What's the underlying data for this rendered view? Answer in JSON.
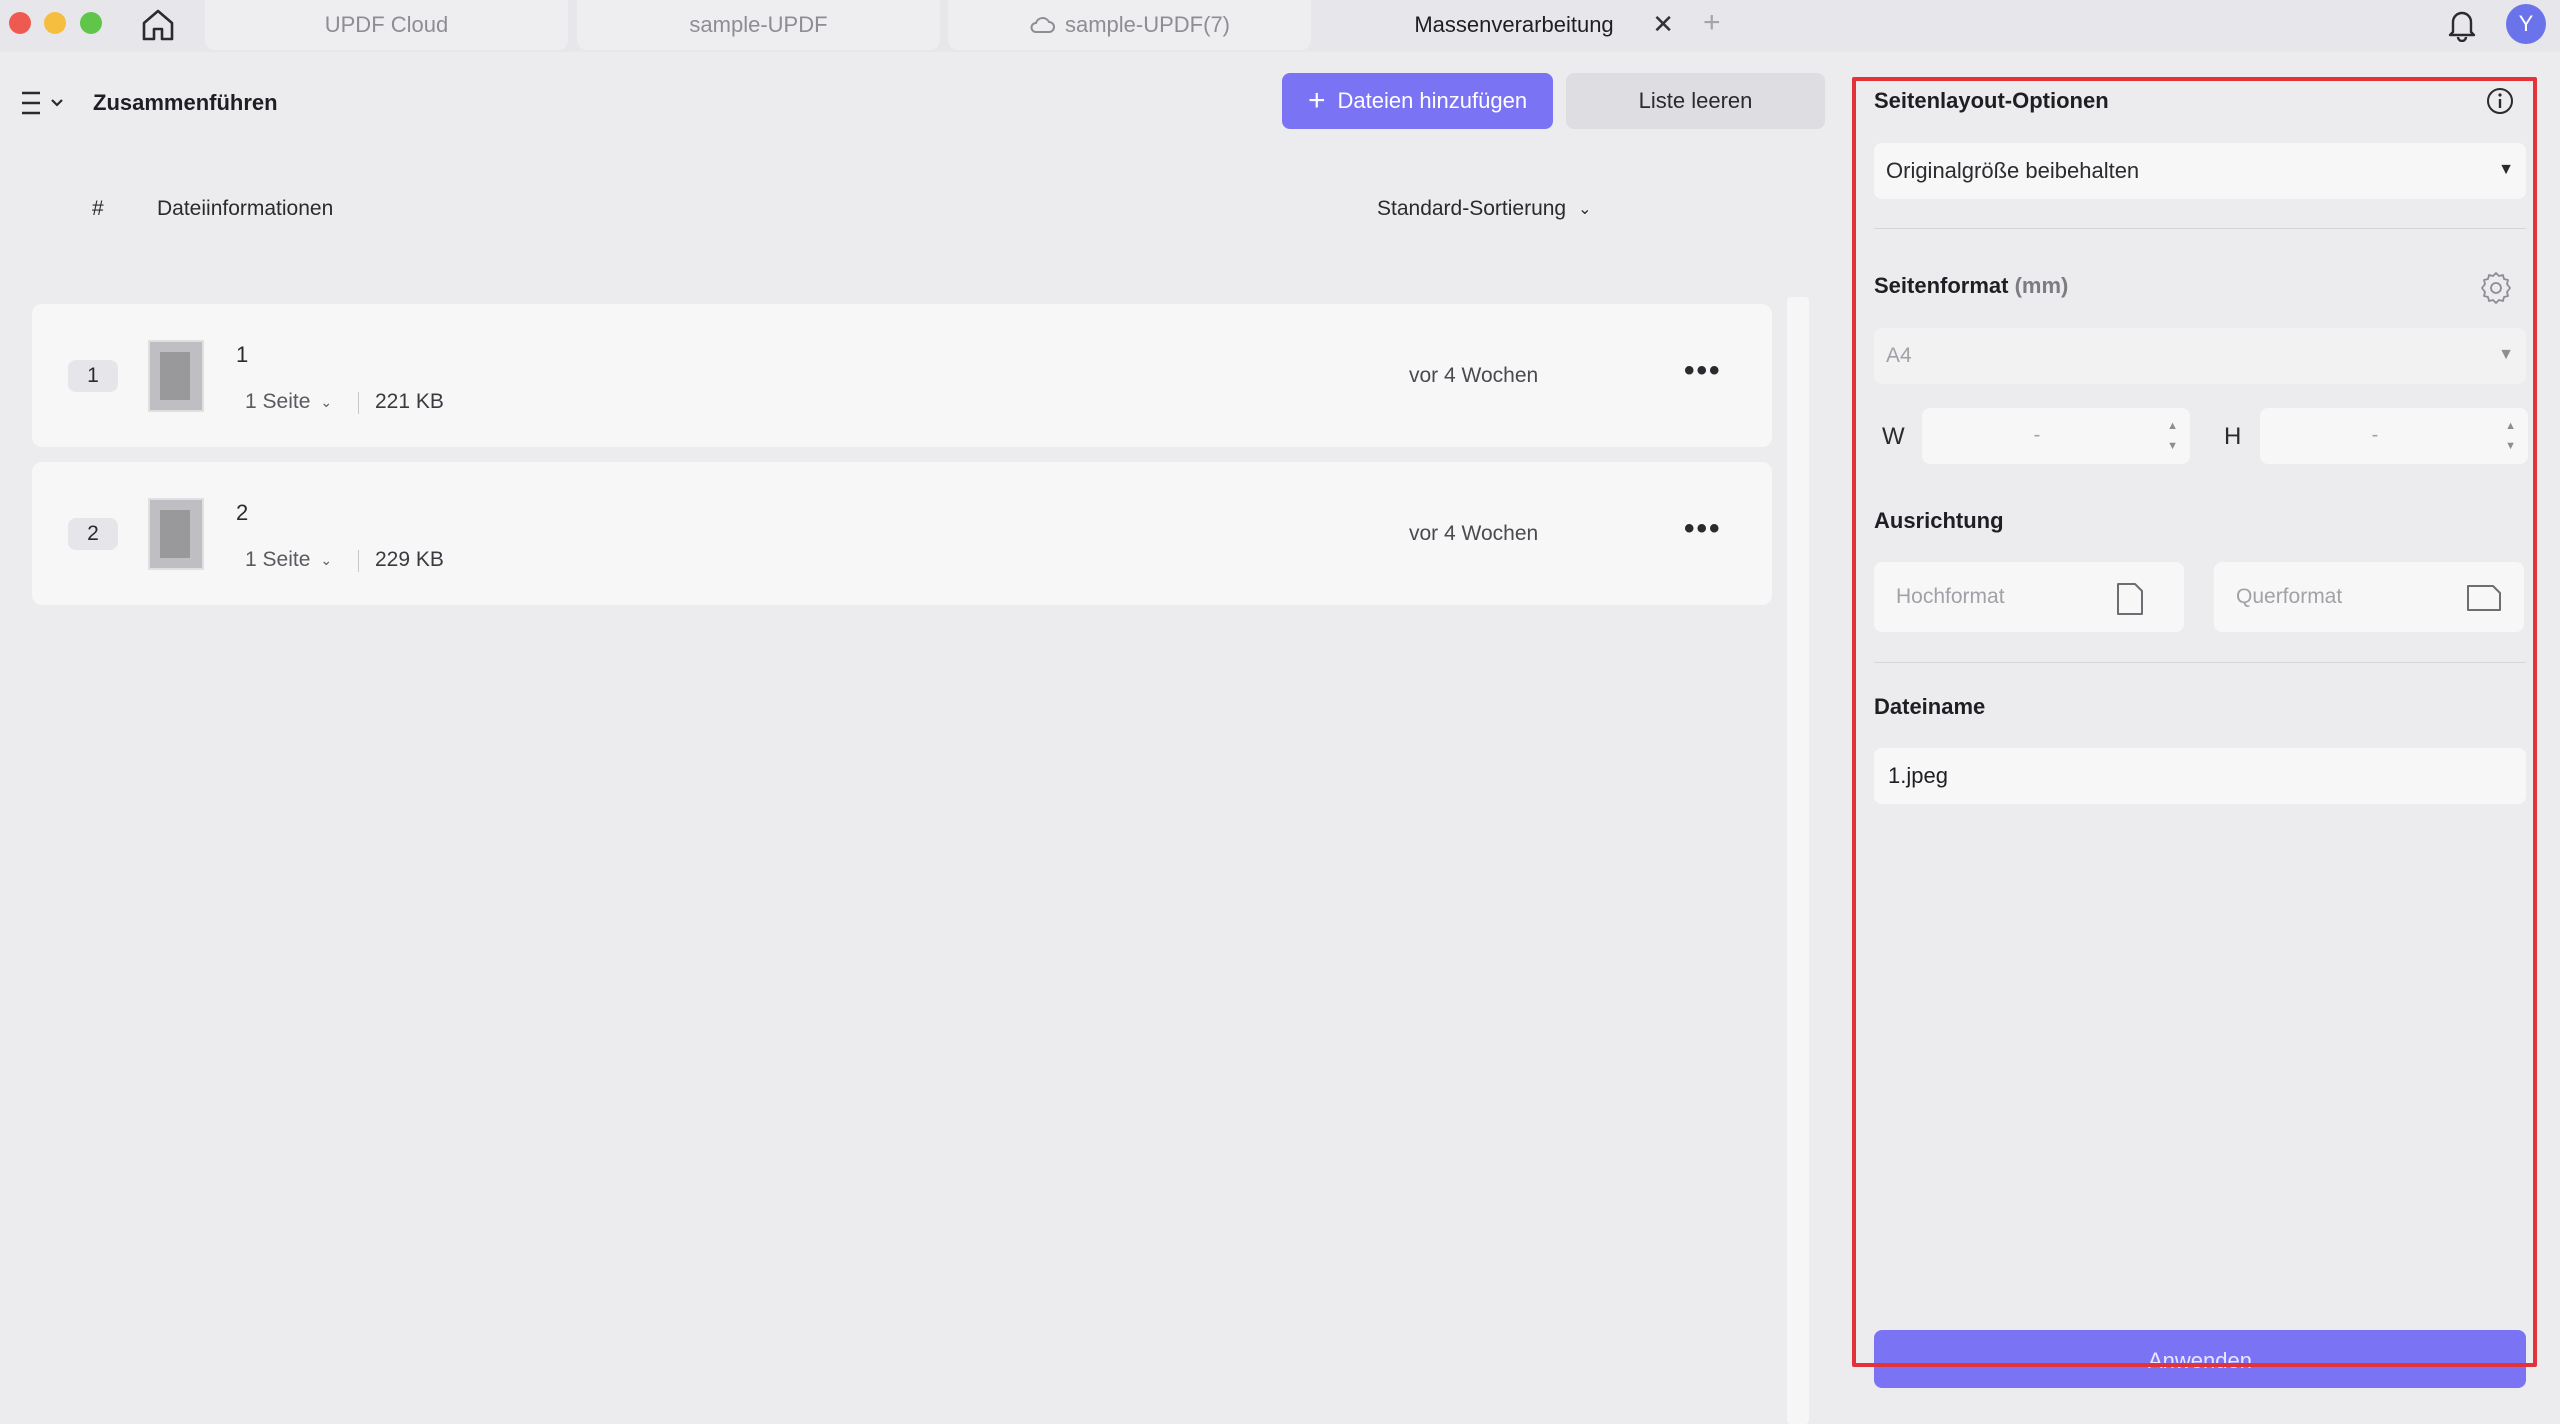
{
  "tabs": [
    {
      "label": "UPDF Cloud"
    },
    {
      "label": "sample-UPDF"
    },
    {
      "label": "sample-UPDF(7)",
      "icon": "cloud-icon"
    },
    {
      "label": "Massenverarbeitung",
      "active": true
    }
  ],
  "tab_close_glyph": "✕",
  "tab_add_glyph": "+",
  "avatar_initial": "Y",
  "toolbar": {
    "title": "Zusammenführen",
    "add_files_label": "Dateien hinzufügen",
    "clear_list_label": "Liste leeren"
  },
  "list": {
    "col_index": "#",
    "col_info": "Dateiinformationen",
    "sort_label": "Standard-Sortierung",
    "files": [
      {
        "index": "1",
        "name": "1",
        "pages": "1 Seite",
        "size": "221 KB",
        "date": "vor 4 Wochen"
      },
      {
        "index": "2",
        "name": "2",
        "pages": "1 Seite",
        "size": "229 KB",
        "date": "vor 4 Wochen"
      }
    ],
    "more_glyph": "•••"
  },
  "panel": {
    "layout_title": "Seitenlayout-Optionen",
    "layout_value": "Originalgröße beibehalten",
    "format_title": "Seitenformat",
    "format_unit": "(mm)",
    "format_value": "A4",
    "width_label": "W",
    "height_label": "H",
    "width_value": "-",
    "height_value": "-",
    "orientation_title": "Ausrichtung",
    "portrait_label": "Hochformat",
    "landscape_label": "Querformat",
    "filename_title": "Dateiname",
    "filename_value": "1.jpeg",
    "apply_label": "Anwenden"
  },
  "colors": {
    "accent": "#7a73f4",
    "highlight_frame": "#e4323a"
  }
}
